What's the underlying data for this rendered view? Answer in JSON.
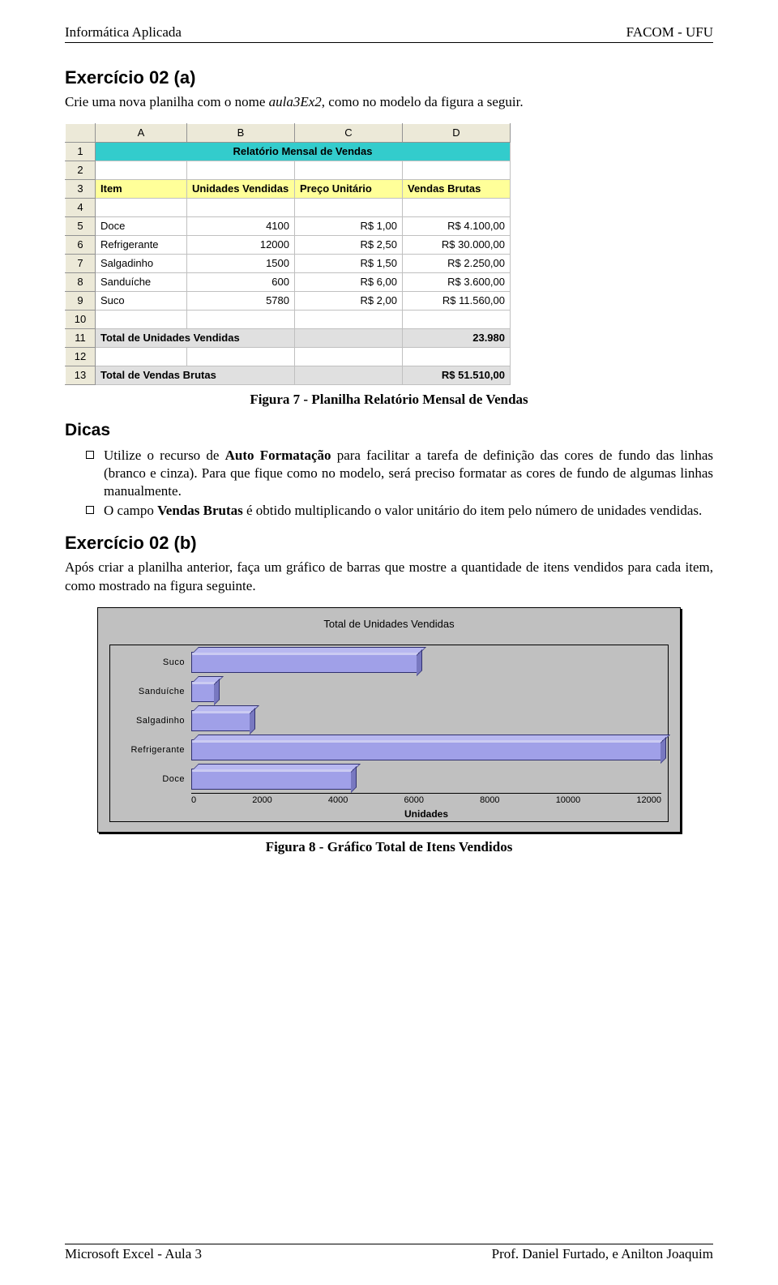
{
  "header": {
    "left": "Informática Aplicada",
    "right": "FACOM - UFU"
  },
  "ex02a": {
    "title": "Exercício 02 (a)",
    "intro_a": "Crie uma nova planilha com o nome ",
    "intro_file": "aula3Ex2",
    "intro_b": ", como no modelo da figura a seguir."
  },
  "sheet": {
    "cols": [
      "A",
      "B",
      "C",
      "D"
    ],
    "rows": [
      "1",
      "2",
      "3",
      "4",
      "5",
      "6",
      "7",
      "8",
      "9",
      "10",
      "11",
      "12",
      "13"
    ],
    "title": "Relatório Mensal de Vendas",
    "headers": [
      "Item",
      "Unidades Vendidas",
      "Preço Unitário",
      "Vendas Brutas"
    ],
    "data": [
      {
        "item": "Doce",
        "units": "4100",
        "price": "R$ 1,00",
        "gross": "R$ 4.100,00"
      },
      {
        "item": "Refrigerante",
        "units": "12000",
        "price": "R$ 2,50",
        "gross": "R$ 30.000,00"
      },
      {
        "item": "Salgadinho",
        "units": "1500",
        "price": "R$ 1,50",
        "gross": "R$ 2.250,00"
      },
      {
        "item": "Sanduíche",
        "units": "600",
        "price": "R$ 6,00",
        "gross": "R$ 3.600,00"
      },
      {
        "item": "Suco",
        "units": "5780",
        "price": "R$ 2,00",
        "gross": "R$ 11.560,00"
      }
    ],
    "total_units_label": "Total de Unidades Vendidas",
    "total_units_value": "23.980",
    "total_gross_label": "Total de Vendas Brutas",
    "total_gross_value": "R$ 51.510,00"
  },
  "fig7": "Figura 7 - Planilha Relatório Mensal de Vendas",
  "dicas": {
    "title": "Dicas",
    "tip1_a": "Utilize o recurso de ",
    "tip1_b": "Auto Formatação",
    "tip1_c": " para facilitar a tarefa de definição das cores de fundo das linhas (branco e cinza). Para que fique como no modelo, será preciso formatar as cores de fundo de algumas linhas manualmente.",
    "tip2_a": "O campo ",
    "tip2_b": "Vendas Brutas",
    "tip2_c": " é obtido multiplicando o valor unitário do item pelo número de unidades vendidas."
  },
  "ex02b": {
    "title": "Exercício 02 (b)",
    "para": "Após criar a planilha anterior, faça um gráfico de barras que mostre a quantidade de itens vendidos para cada item, como mostrado na figura seguinte."
  },
  "chart_data": {
    "type": "bar",
    "title": "Total de Unidades Vendidas",
    "xlabel": "Unidades",
    "ylabel": "",
    "xlim": [
      0,
      12000
    ],
    "categories": [
      "Suco",
      "Sanduíche",
      "Salgadinho",
      "Refrigerante",
      "Doce"
    ],
    "values": [
      5780,
      600,
      1500,
      12000,
      4100
    ],
    "x_ticks": [
      "0",
      "2000",
      "4000",
      "6000",
      "8000",
      "10000",
      "12000"
    ]
  },
  "fig8": "Figura 8 - Gráfico Total de Itens Vendidos",
  "footer": {
    "left": "Microsoft Excel - Aula 3",
    "right": "Prof. Daniel Furtado, e Anilton Joaquim"
  }
}
